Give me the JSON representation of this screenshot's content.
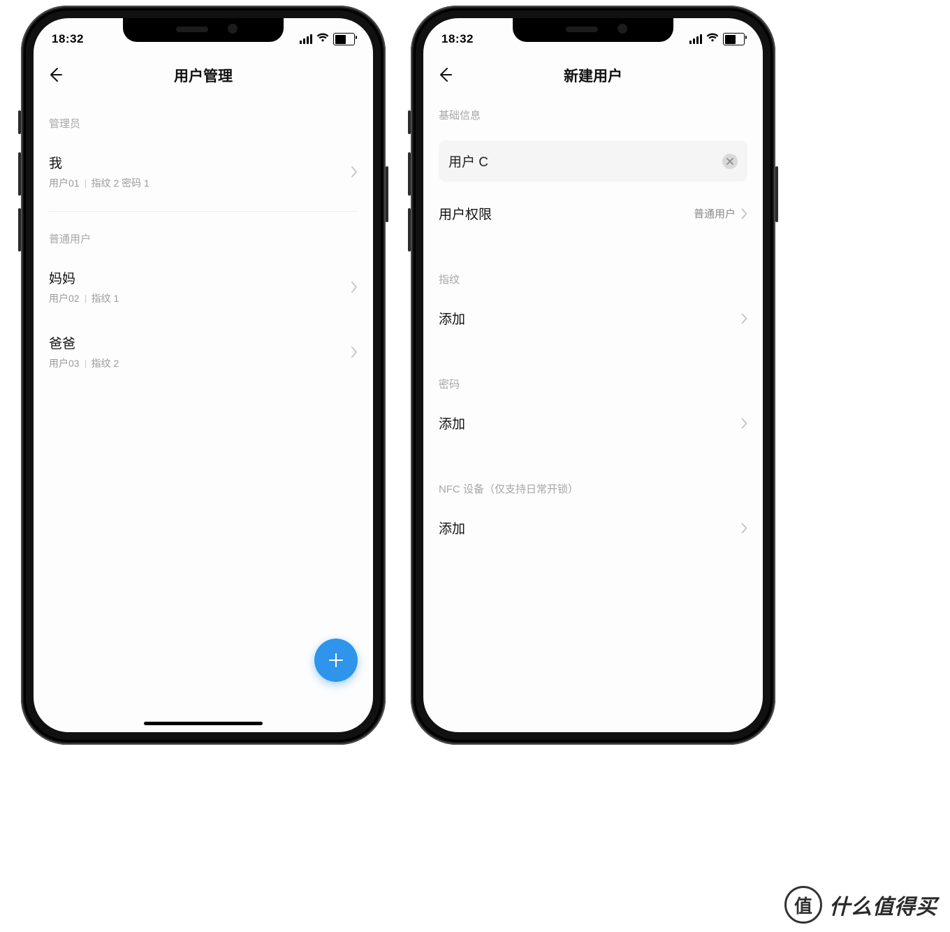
{
  "status": {
    "time": "18:32"
  },
  "screen1": {
    "title": "用户管理",
    "section_admin": "管理员",
    "section_normal": "普通用户",
    "admins": [
      {
        "name": "我",
        "id": "用户01",
        "detail": "指纹 2 密码 1"
      }
    ],
    "users": [
      {
        "name": "妈妈",
        "id": "用户02",
        "detail": "指纹 1"
      },
      {
        "name": "爸爸",
        "id": "用户03",
        "detail": "指纹 2"
      }
    ]
  },
  "screen2": {
    "title": "新建用户",
    "section_basic": "基础信息",
    "name_value": "用户 C",
    "perm_label": "用户权限",
    "perm_value": "普通用户",
    "section_finger": "指纹",
    "section_pwd": "密码",
    "section_nfc": "NFC 设备（仅支持日常开锁）",
    "add_label": "添加"
  },
  "watermark": {
    "badge": "值",
    "text": "什么值得买"
  }
}
